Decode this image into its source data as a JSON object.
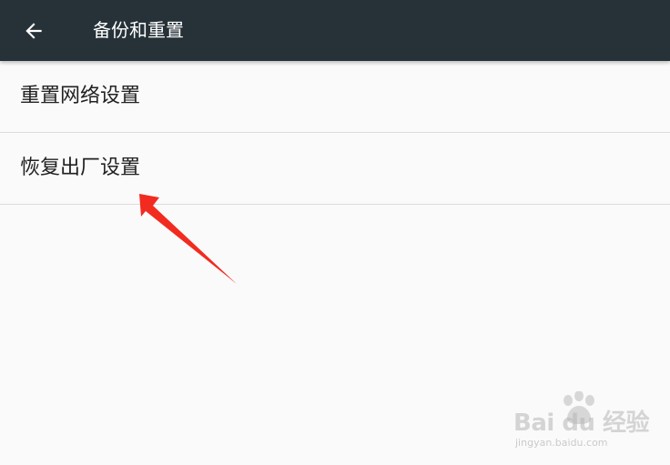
{
  "toolbar": {
    "title": "备份和重置",
    "back_icon": "arrow-left-icon",
    "background_color": "#263238"
  },
  "list": {
    "items": [
      {
        "label": "重置网络设置"
      },
      {
        "label": "恢复出厂设置"
      }
    ]
  },
  "annotation": {
    "arrow_color": "#f22b20"
  },
  "watermark": {
    "brand": "Bai du 经验",
    "subtext": "jingyan.baidu.com",
    "icon": "paw-icon"
  }
}
